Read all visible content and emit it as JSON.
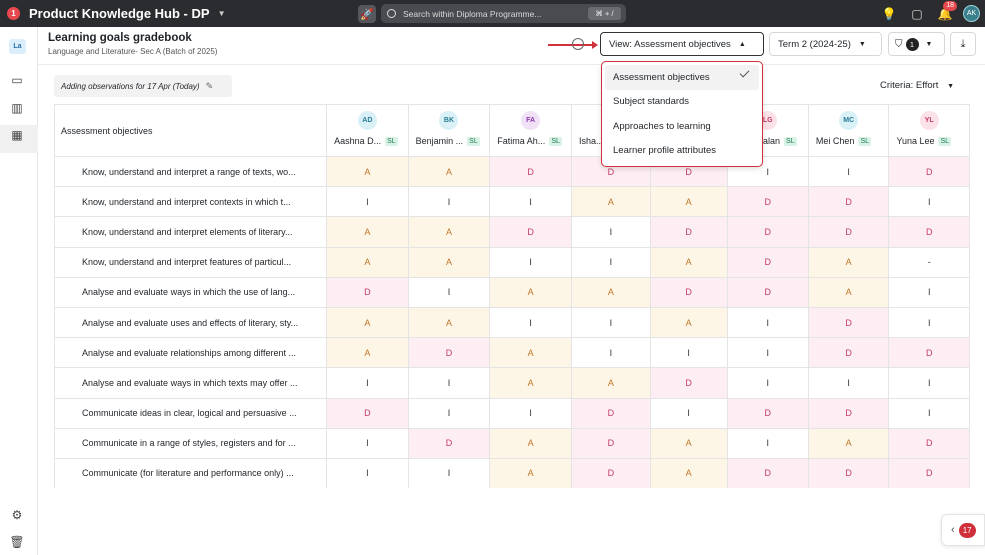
{
  "topbar": {
    "logo_text": "1",
    "app_title": "Product Knowledge Hub - DP",
    "search_placeholder": "Search within Diploma Programme...",
    "search_shortcut": "⌘ + /",
    "notification_count": "18",
    "avatar_initials": "AK"
  },
  "sidebar": {
    "badge": "La"
  },
  "header": {
    "title": "Learning goals gradebook",
    "subtitle": "Language and Literature- Sec A (Batch of 2025)",
    "view_label": "View: Assessment objectives",
    "term_label": "Term 2 (2024-25)",
    "filter_count": "1"
  },
  "observation_chip": "Adding observations for 17 Apr (Today)",
  "criteria_label": "Criteria: Effort",
  "table": {
    "header_label": "Assessment objectives",
    "sl_tag": "SL",
    "students": [
      {
        "initials": "AD",
        "name": "Aashna D...",
        "bg": "#d9f0f7",
        "fg": "#2a7c93"
      },
      {
        "initials": "BK",
        "name": "Benjamin ...",
        "bg": "#d9f0f7",
        "fg": "#2a7c93"
      },
      {
        "initials": "FA",
        "name": "Fatima Ah...",
        "bg": "#f0e1f7",
        "fg": "#8d3aa8"
      },
      {
        "initials": "IS",
        "name": "Isha...",
        "bg": "#d9f0f7",
        "fg": "#2a7c93"
      },
      {
        "initials": "JM",
        "name": "...",
        "bg": "#d9f0f7",
        "fg": "#2a7c93"
      },
      {
        "initials": "LG",
        "name": "...cia Galan",
        "bg": "#fbe1e8",
        "fg": "#c53a66"
      },
      {
        "initials": "MC",
        "name": "Mei Chen",
        "bg": "#d9f0f7",
        "fg": "#2a7c93"
      },
      {
        "initials": "YL",
        "name": "Yuna Lee",
        "bg": "#fbe1e8",
        "fg": "#c53a66"
      }
    ],
    "rows": [
      {
        "objective": "Know, understand and interpret a range of texts, wo...",
        "grades": [
          "A",
          "A",
          "D",
          "D",
          "D",
          "I",
          "I",
          "D"
        ]
      },
      {
        "objective": "Know, understand and interpret contexts in which t...",
        "grades": [
          "I",
          "I",
          "I",
          "A",
          "A",
          "D",
          "D",
          "I"
        ]
      },
      {
        "objective": "Know, understand and interpret elements of literary...",
        "grades": [
          "A",
          "A",
          "D",
          "I",
          "D",
          "D",
          "D",
          "D"
        ]
      },
      {
        "objective": "Know, understand and interpret features of particul...",
        "grades": [
          "A",
          "A",
          "I",
          "I",
          "A",
          "D",
          "A",
          "-"
        ]
      },
      {
        "objective": "Analyse and evaluate ways in which the use of lang...",
        "grades": [
          "D",
          "I",
          "A",
          "A",
          "D",
          "D",
          "A",
          "I"
        ]
      },
      {
        "objective": "Analyse and evaluate uses and effects of literary, sty...",
        "grades": [
          "A",
          "A",
          "I",
          "I",
          "A",
          "I",
          "D",
          "I"
        ]
      },
      {
        "objective": "Analyse and evaluate relationships among different ...",
        "grades": [
          "A",
          "D",
          "A",
          "I",
          "I",
          "I",
          "D",
          "D"
        ]
      },
      {
        "objective": "Analyse and evaluate ways in which texts may offer ...",
        "grades": [
          "I",
          "I",
          "A",
          "A",
          "D",
          "I",
          "I",
          "I"
        ]
      },
      {
        "objective": "Communicate ideas in clear, logical and persuasive ...",
        "grades": [
          "D",
          "I",
          "I",
          "D",
          "I",
          "D",
          "D",
          "I"
        ]
      },
      {
        "objective": "Communicate in a range of styles, registers and for ...",
        "grades": [
          "I",
          "D",
          "A",
          "D",
          "A",
          "I",
          "A",
          "D"
        ]
      },
      {
        "objective": "Communicate (for literature and performance only) ...",
        "grades": [
          "I",
          "I",
          "A",
          "D",
          "A",
          "D",
          "D",
          "D"
        ]
      }
    ]
  },
  "view_menu": {
    "items": [
      "Assessment objectives",
      "Subject standards",
      "Approaches to learning",
      "Learner profile attributes"
    ],
    "selected_index": 0
  },
  "floating_badge": "17",
  "colors": {
    "topbar": "#2b2c30",
    "accent_red": "#d0303c",
    "grade_A_bg": "#fdf6e7",
    "grade_D_bg": "#fceef3"
  }
}
